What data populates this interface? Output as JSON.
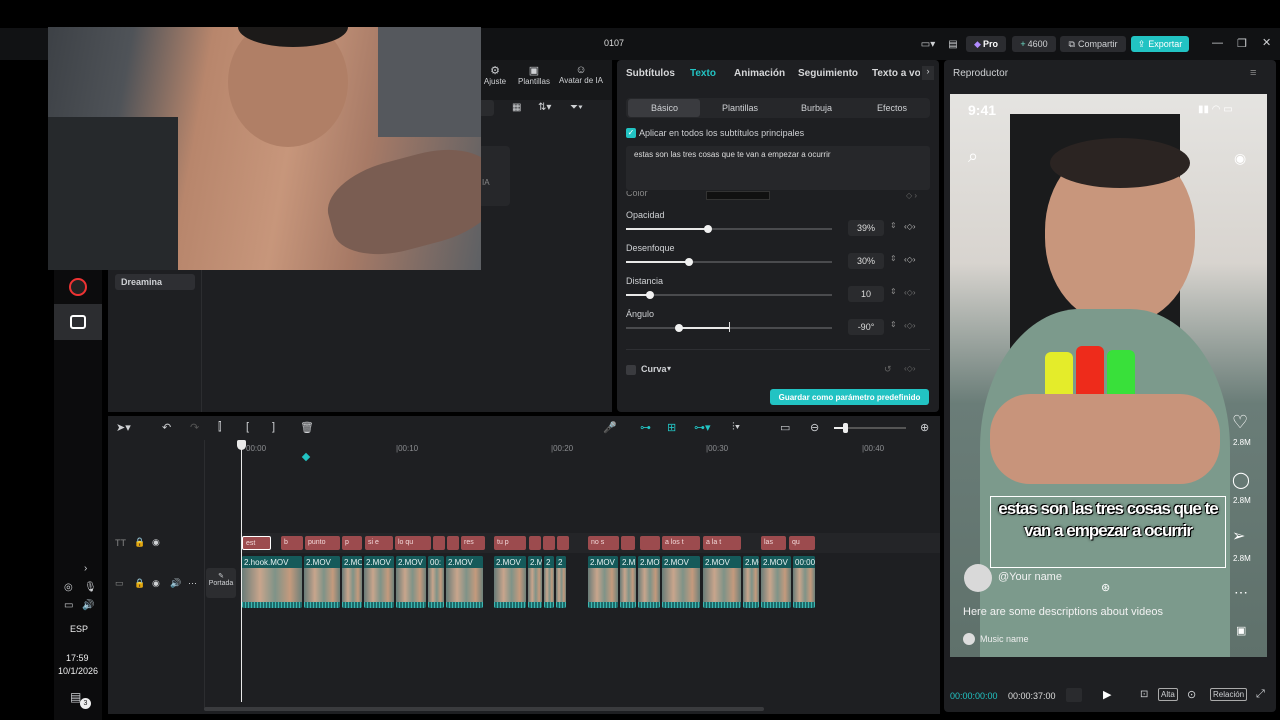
{
  "window": {
    "title": "0107",
    "credits": "4600",
    "pro_label": "Pro",
    "share_label": "Compartir",
    "export_label": "Exportar"
  },
  "left_toolbar": {
    "ajuste": "Ajuste",
    "plantillas": "Plantillas",
    "avatar": "Avatar de IA"
  },
  "media_panel": {
    "dreamina": "Dreamina",
    "partial_text": "IA"
  },
  "props": {
    "tabs": [
      "Subtítulos",
      "Texto",
      "Animación",
      "Seguimiento",
      "Texto a vo"
    ],
    "subtabs": [
      "Básico",
      "Plantillas",
      "Burbuja",
      "Efectos"
    ],
    "apply_all": "Aplicar en todos los subtítulos principales",
    "text_value": "estas son las tres cosas que te van a empezar a ocurrir",
    "color_label": "Color",
    "opacity": {
      "label": "Opacidad",
      "value": "39%",
      "level": 0.39
    },
    "blur": {
      "label": "Desenfoque",
      "value": "30%",
      "level": 0.3
    },
    "distance": {
      "label": "Distancia",
      "value": "10",
      "level": 0.1
    },
    "angle": {
      "label": "Ángulo",
      "value": "-90°",
      "level": 0.25
    },
    "curve": "Curva",
    "save_preset": "Guardar como parámetro predefinido"
  },
  "player": {
    "title": "Reproductor",
    "status_time": "9:41",
    "caption": "estas son las tres cosas que te van a empezar a ocurrir",
    "username": "@Your name",
    "description": "Here are some descriptions about videos",
    "music": "Music name",
    "likes": "2.8M",
    "comments": "2.8M",
    "shares": "2.8M",
    "current_time": "00:00:00:00",
    "total_time": "00:00:37:00",
    "quality": "Alta",
    "ratio": "Relación"
  },
  "timeline": {
    "ruler": [
      "00:00",
      "|00:10",
      "|00:20",
      "|00:30",
      "|00:40"
    ],
    "cover_label": "Portada",
    "text_clips": [
      "est",
      "b",
      "punto",
      "p",
      "si e",
      "lo qu",
      "",
      "",
      "res",
      "tu p",
      "",
      "",
      "",
      "no s",
      "",
      "",
      "a los t",
      "a la t",
      "las",
      "qu"
    ],
    "video_clips": [
      "2.hook.MOV",
      "2.MOV",
      "2.MOV",
      "2.MOV",
      "2.MOV",
      "00:",
      "2.MOV",
      "2.MOV",
      "2.M",
      "2",
      "2",
      "2.MOV",
      "2.M",
      "2.MOV",
      "2.MOV",
      "2.MOV",
      "2.MOV",
      "2.MOV",
      "00:00"
    ]
  },
  "taskbar": {
    "lang": "ESP",
    "time": "17:59",
    "date": "10/1/2026",
    "notif_count": "3"
  }
}
